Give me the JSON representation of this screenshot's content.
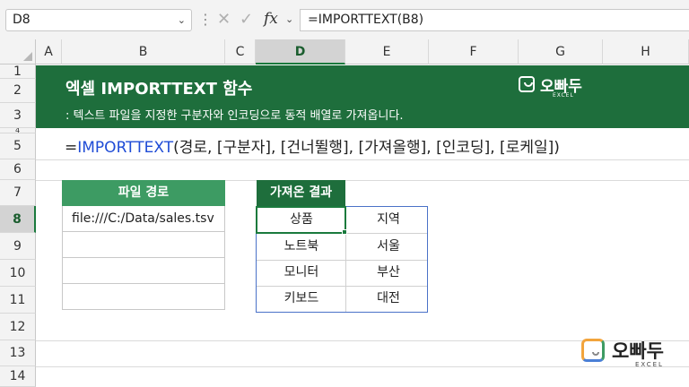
{
  "formula_bar": {
    "name_box": "D8",
    "formula": "=IMPORTTEXT(B8)",
    "fx_label": "fx"
  },
  "columns": [
    "A",
    "B",
    "C",
    "D",
    "E",
    "F",
    "G",
    "H"
  ],
  "rows": [
    "1",
    "2",
    "3",
    "4",
    "5",
    "6",
    "7",
    "8",
    "9",
    "10",
    "11",
    "12",
    "13",
    "14"
  ],
  "banner": {
    "title": "엑셀 IMPORTTEXT 함수",
    "subtitle": ": 텍스트 파일을 지정한 구분자와 인코딩으로 동적 배열로 가져옵니다.",
    "logo_text": "오빠두",
    "logo_small": "EXCEL"
  },
  "syntax": {
    "prefix": "=",
    "fn": "IMPORTTEXT",
    "args": "(경로, [구분자], [건너뛸행], [가져올행], [인코딩], [로케일])"
  },
  "path_table": {
    "header": "파일 경로",
    "cells": [
      "file:///C:/Data/sales.tsv",
      "",
      "",
      ""
    ]
  },
  "result": {
    "label": "가져온 결과",
    "rows": [
      [
        "상품",
        "지역"
      ],
      [
        "노트북",
        "서울"
      ],
      [
        "모니터",
        "부산"
      ],
      [
        "키보드",
        "대전"
      ]
    ]
  },
  "watermark": {
    "text": "오빠두",
    "small": "EXCEL"
  },
  "colors": {
    "banner": "#1e6e3c",
    "table_header": "#3d9b63",
    "function_blue": "#1f4cd6",
    "selection": "#1a7a3d"
  }
}
